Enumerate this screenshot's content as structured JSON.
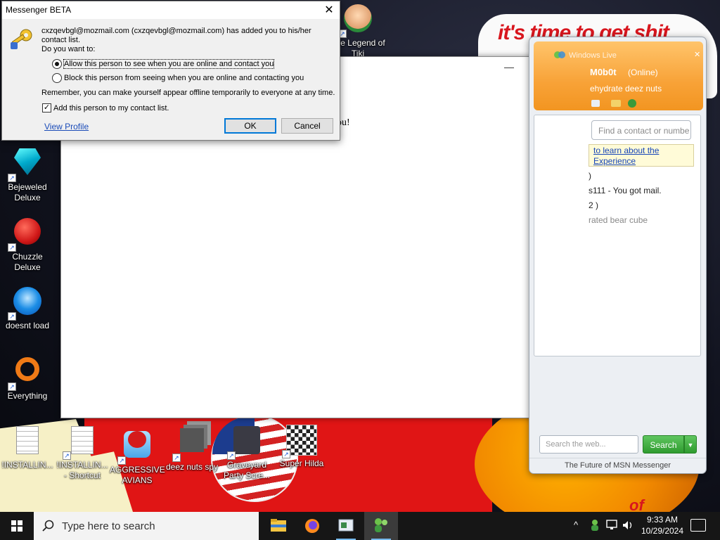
{
  "wallpaper": {
    "slogan": "it's time to get shit",
    "slogan_tail": "of"
  },
  "desktop_icons": [
    {
      "label": "The Legend of Tiki",
      "icon": "legend-game-icon"
    },
    {
      "label": "Bejeweled Deluxe",
      "icon": "bejeweled-icon"
    },
    {
      "label": "Chuzzle Deluxe",
      "icon": "chuzzle-icon"
    },
    {
      "label": "doesnt load",
      "icon": "thunderbird-icon"
    },
    {
      "label": "Everything",
      "icon": "everything-search-icon"
    },
    {
      "label": "!INSTALLIN...",
      "icon": "document-icon"
    },
    {
      "label": "!INSTALLIN... - Shortcut",
      "icon": "document-shortcut-icon"
    },
    {
      "label": "AGGRESSIVE AVIANS",
      "icon": "angry-bird-icon"
    },
    {
      "label": "deez nuts spy",
      "icon": "stacked-windows-icon"
    },
    {
      "label": "Graveyard Party Scre...",
      "icon": "graveyard-icon"
    },
    {
      "label": "Super Hilda",
      "icon": "pixel-game-icon"
    }
  ],
  "main_window": {
    "text_fragment": "ou!",
    "minimize": "—",
    "maximize": "☐",
    "close": "✕"
  },
  "wlm": {
    "title": "Windows Live",
    "name": "M0b0t",
    "status": "(Online)",
    "personal_message": "ehydrate deez nuts",
    "search_placeholder": "Find a contact or numbe",
    "banner_line1": "to learn about the",
    "banner_line2": "Experience",
    "list": [
      ")",
      "s111 - You got mail.",
      "2 )",
      "rated bear cube"
    ],
    "web_search_placeholder": "Search the web...",
    "search_button": "Search",
    "footer": "The Future of MSN Messenger",
    "accent": "#f8a237"
  },
  "dialog": {
    "title": "Messenger BETA",
    "message": "cxzqevbgl@mozmail.com (cxzqevbgl@mozmail.com) has added you to his/her contact list.",
    "question": "Do you want to:",
    "option_allow": "Allow this person to see when you are online and contact you",
    "option_block": "Block this person from seeing when you are online and contacting you",
    "selected_option": "allow",
    "note": "Remember, you can make yourself appear offline temporarily to everyone at any time.",
    "add_contact_label": "Add this person to my contact list.",
    "add_contact_checked": true,
    "view_profile": "View Profile",
    "ok": "OK",
    "cancel": "Cancel"
  },
  "taskbar": {
    "search_placeholder": "Type here to search",
    "time": "9:33 AM",
    "date": "10/29/2024",
    "apps": [
      "file-explorer-icon",
      "firefox-icon",
      "control-panel-icon",
      "messenger-icon"
    ]
  }
}
